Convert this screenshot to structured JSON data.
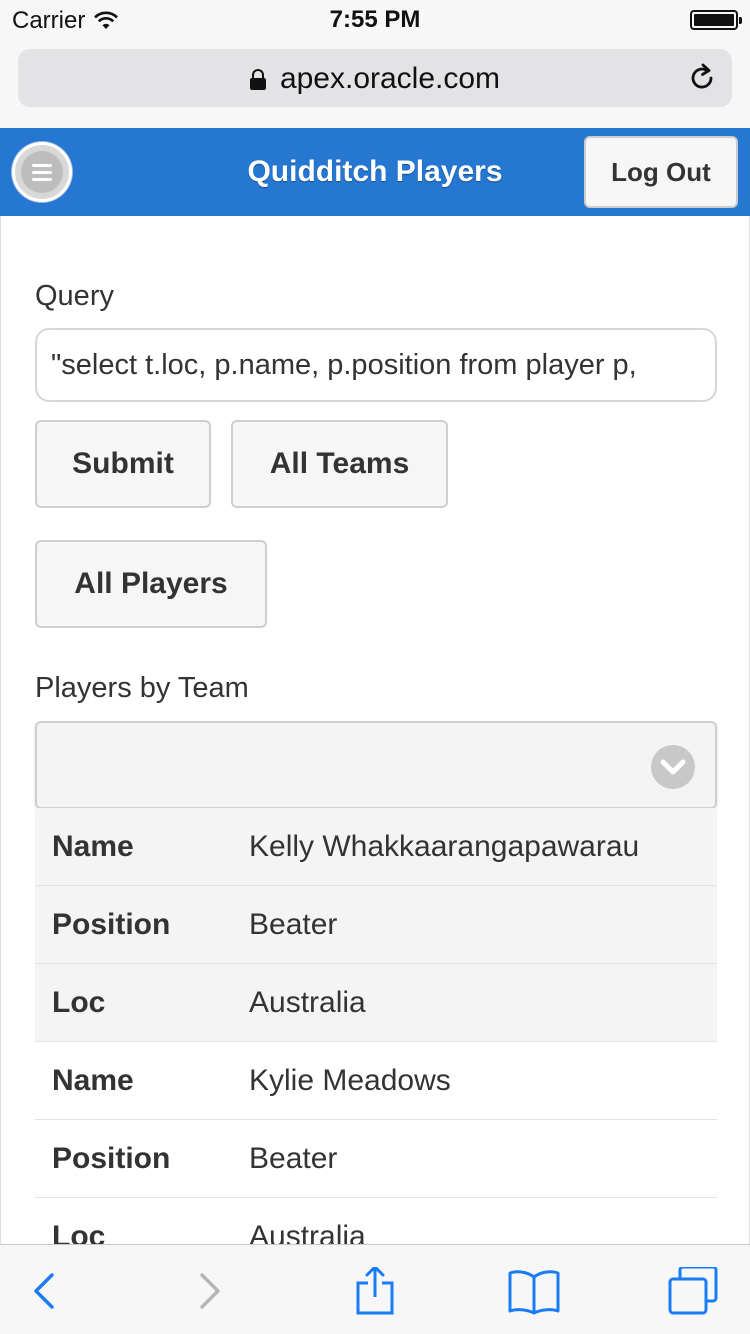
{
  "status_bar": {
    "carrier": "Carrier",
    "time": "7:55 PM"
  },
  "browser": {
    "url": "apex.oracle.com"
  },
  "header": {
    "title": "Quidditch Players",
    "logout_label": "Log Out"
  },
  "query": {
    "label": "Query",
    "value": "\"select t.loc, p.name, p.position from player p,"
  },
  "buttons": {
    "submit": "Submit",
    "all_teams": "All Teams",
    "all_players": "All Players"
  },
  "players_by_team": {
    "label": "Players by Team",
    "selected": ""
  },
  "records": [
    {
      "key": "Name",
      "value": "Kelly Whakkaarangapawarau"
    },
    {
      "key": "Position",
      "value": "Beater"
    },
    {
      "key": "Loc",
      "value": "Australia"
    },
    {
      "key": "Name",
      "value": "Kylie Meadows"
    },
    {
      "key": "Position",
      "value": "Beater"
    },
    {
      "key": "Loc",
      "value": "Australia"
    }
  ],
  "colors": {
    "header_bg": "#2577d1",
    "ios_blue": "#1a7cf5"
  }
}
